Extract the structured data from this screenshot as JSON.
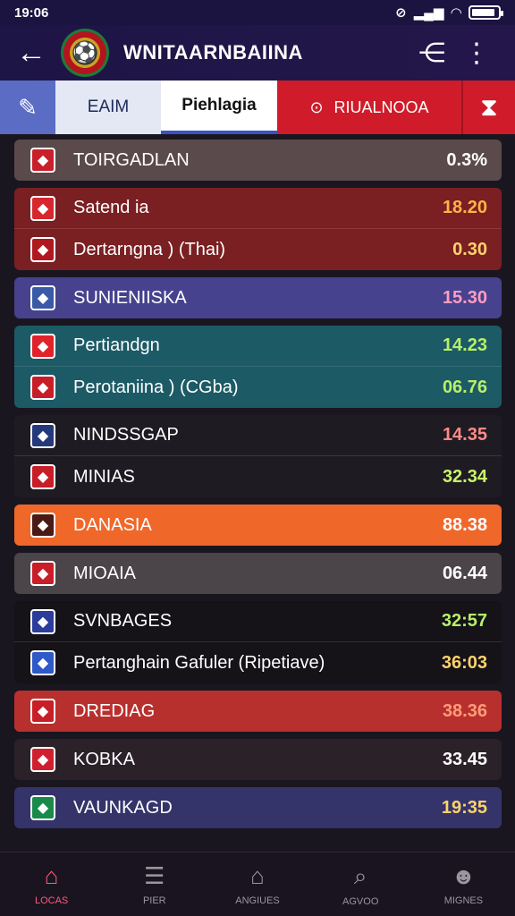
{
  "status": {
    "time": "19:06",
    "battery_level": 0.9
  },
  "appbar": {
    "title": "WNITAARNBAIINA",
    "back_icon": "back-arrow-icon",
    "share_icon": "share-icon",
    "more_icon": "more-vertical-icon"
  },
  "tabs": {
    "tab1": "EAIM",
    "tab2": "Piehlagia",
    "tab3": "RIUALNOOA"
  },
  "groups": [
    {
      "bg": "#5a4a4c",
      "rows": [
        {
          "name": "TOIRGADLAN",
          "value": "0.3%",
          "value_color": "#ffffff",
          "flag": "#c8202a"
        }
      ]
    },
    {
      "bg": "#7a1f22",
      "rows": [
        {
          "name": "Satend ia",
          "value": "18.20",
          "value_color": "#ffb347",
          "flag": "#d7262e"
        },
        {
          "name": "Dertarngna ) (Thai)",
          "value": "0.30",
          "value_color": "#ffd36b",
          "flag": "#b01820"
        }
      ]
    },
    {
      "bg": "#46428e",
      "rows": [
        {
          "name": "SUNIENIISKA",
          "value": "15.30",
          "value_color": "#ff9cc2",
          "flag": "#3a5aa8"
        }
      ]
    },
    {
      "bg": "#1c5a66",
      "rows": [
        {
          "name": "Pertiandgn",
          "value": "14.23",
          "value_color": "#b7f06a",
          "flag": "#e0222b"
        },
        {
          "name": "Perotaniina ) (CGba)",
          "value": "06.76",
          "value_color": "#b7f06a",
          "flag": "#c81e28"
        }
      ]
    },
    {
      "bg": "#1f1b22",
      "rows": [
        {
          "name": "NINDSSGAP",
          "value": "14.35",
          "value_color": "#ff8a8a",
          "flag": "#25397a"
        },
        {
          "name": "MINIAS",
          "value": "32.34",
          "value_color": "#c9f56b",
          "flag": "#c81e28"
        }
      ]
    },
    {
      "bg": "#f0672a",
      "rows": [
        {
          "name": "DANASIA",
          "value": "88.38",
          "value_color": "#ffffff",
          "flag": "#4a1a14"
        }
      ]
    },
    {
      "bg": "#4b4448",
      "rows": [
        {
          "name": "MIOAIA",
          "value": "06.44",
          "value_color": "#ffffff",
          "flag": "#c81e28"
        }
      ]
    },
    {
      "bg": "#151218",
      "rows": [
        {
          "name": "SVNBAGES",
          "value": "32:57",
          "value_color": "#b7f06a",
          "flag": "#2b3c9c"
        },
        {
          "name": "Pertanghain Gafuler (Ripetiave)",
          "value": "36:03",
          "value_color": "#ffd36b",
          "flag": "#2f58c8"
        }
      ]
    },
    {
      "bg": "#b8302e",
      "rows": [
        {
          "name": "DREDIAG",
          "value": "38.36",
          "value_color": "#ff9c7a",
          "flag": "#c81e28"
        }
      ]
    },
    {
      "bg": "#2a2228",
      "rows": [
        {
          "name": "KOBKA",
          "value": "33.45",
          "value_color": "#ffffff",
          "flag": "#d02030"
        }
      ]
    },
    {
      "bg": "#34346a",
      "rows": [
        {
          "name": "VAUNKAGD",
          "value": "19:35",
          "value_color": "#ffd36b",
          "flag": "#1a8a4a"
        }
      ]
    }
  ],
  "nav": [
    {
      "label": "LOCAS",
      "icon": "home-icon",
      "glyph": "⌂",
      "active": true
    },
    {
      "label": "PIER",
      "icon": "list-icon",
      "glyph": "☰",
      "active": false
    },
    {
      "label": "ANGIUES",
      "icon": "building-icon",
      "glyph": "⌂",
      "active": false
    },
    {
      "label": "AGVOO",
      "icon": "search-icon",
      "glyph": "⌕",
      "active": false
    },
    {
      "label": "MIGNES",
      "icon": "profile-icon",
      "glyph": "☻",
      "active": false
    }
  ]
}
